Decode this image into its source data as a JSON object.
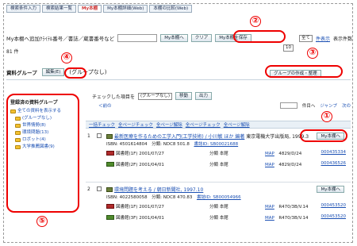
{
  "tabs": [
    "検索条件入力",
    "検索結果一覧",
    "My本棚",
    "My本棚詳細(Web)",
    "本棚の比較(Web)"
  ],
  "search": {
    "label": "My本棚へ追加ｸﾗｲﾃﾙ番号／書誌／蔵書番号など",
    "go": "My本棚へ",
    "clear": "クリア",
    "save": "My本棚を保存"
  },
  "sort": {
    "value": "全て",
    "per_page": "10",
    "link1": "件表示",
    "link2": "表示件数"
  },
  "count": "81 件",
  "group": {
    "label": "資料グループ",
    "edit": "編集(E)",
    "none": "(グループなし)",
    "right_button": "グループの作成・整理"
  },
  "sidebar": {
    "title": "登録済の資料グループ",
    "items": [
      "全ての資料を表示する",
      "(グループなし)",
      "世界情勢(8)",
      "環境問題(13)",
      "ロボット(4)",
      "大学推薦図書(9)"
    ]
  },
  "main": {
    "checked_label": "チェックした項目を",
    "group_select": "(グループなし)",
    "move": "移動",
    "output": "出力",
    "prev": "＜前の",
    "page_info": "件目へ",
    "jump": "ジャンプ",
    "next": "次の"
  },
  "ops": [
    "一括チェック",
    "全ページチェック",
    "全ページ解除",
    "全ページチェック",
    "全ページ解除"
  ],
  "records": [
    {
      "num": "1",
      "title": "最新医療を作るための工学入門(工学技術) / 小川敏 ほか 編著",
      "sub": "東京電機大学出版局, 1999.3",
      "isbn": "ISBN: 4501614804",
      "ndc": "分類: NDC8 501.8",
      "extra": "書誌ID: SB00021688",
      "holdings": [
        {
          "loc": "図書館(1F) 2001/07/27",
          "cls": "分類 本館",
          "map": "MAP",
          "call": "4829/D/24",
          "bib": "000435334"
        },
        {
          "loc": "図書館(2F) 2001/04/01",
          "cls": "分類 本館",
          "map": "MAP",
          "call": "4829/D/24",
          "bib": "000436526"
        }
      ],
      "add": "My本棚へ"
    },
    {
      "num": "2",
      "title": "環境問題を考える / 朝日新聞社, 1997.10",
      "sub": "",
      "isbn": "ISBN: 4022580058",
      "ndc": "分類: NDC8 470.83",
      "extra": "書誌ID: SB00054966",
      "holdings": [
        {
          "loc": "図書館(1F) 2001/07/27",
          "cls": "分類 本館",
          "map": "MAP",
          "call": "R470/3B/V.14",
          "bib": "000453520"
        },
        {
          "loc": "図書館(3F) 2001/04/01",
          "cls": "分類 本館",
          "map": "MAP",
          "call": "R470/3B/V.14",
          "bib": "000453520"
        }
      ],
      "add": "My本棚へ"
    }
  ],
  "markers": [
    "①",
    "②",
    "③",
    "④",
    "⑤"
  ]
}
